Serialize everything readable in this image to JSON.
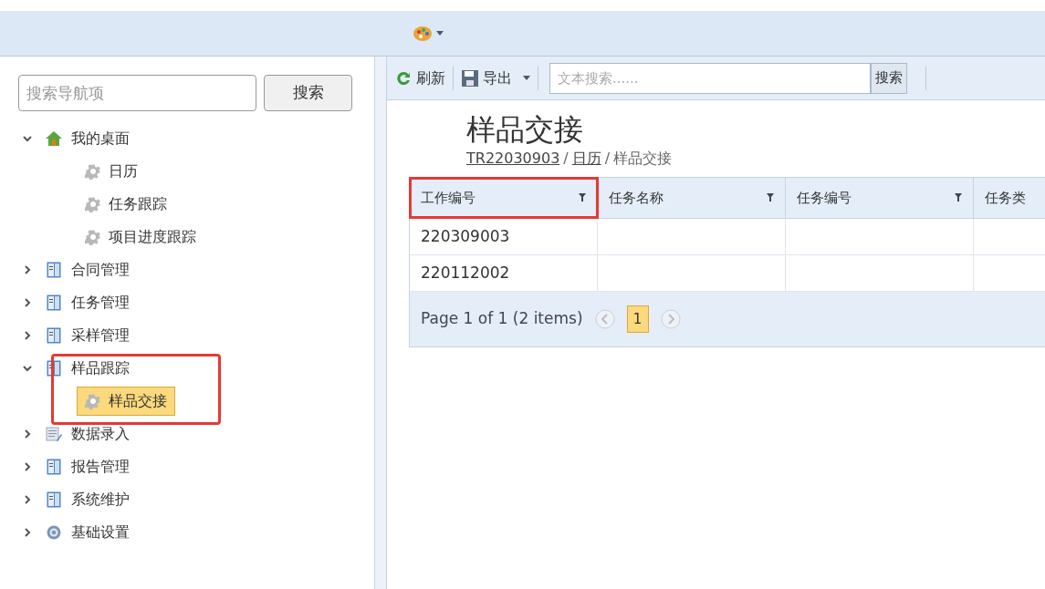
{
  "nav": {
    "search": {
      "placeholder": "搜索导航项"
    },
    "search_button": "搜索",
    "tree": [
      {
        "label": "我的桌面",
        "kind": "home",
        "expanded": true,
        "children": [
          {
            "label": "日历",
            "selected": false
          },
          {
            "label": "任务跟踪",
            "selected": false
          },
          {
            "label": "项目进度跟踪",
            "selected": false
          }
        ]
      },
      {
        "label": "合同管理",
        "kind": "book",
        "expanded": false
      },
      {
        "label": "任务管理",
        "kind": "book",
        "expanded": false
      },
      {
        "label": "采样管理",
        "kind": "book",
        "expanded": false
      },
      {
        "label": "样品跟踪",
        "kind": "book",
        "expanded": true,
        "annotated": true,
        "children": [
          {
            "label": "样品交接",
            "selected": true
          }
        ]
      },
      {
        "label": "数据录入",
        "kind": "list",
        "expanded": false
      },
      {
        "label": "报告管理",
        "kind": "book",
        "expanded": false
      },
      {
        "label": "系统维护",
        "kind": "book",
        "expanded": false
      },
      {
        "label": "基础设置",
        "kind": "gear",
        "expanded": false
      }
    ]
  },
  "toolbar": {
    "refresh": "刷新",
    "export": "导出",
    "search": {
      "placeholder": "文本搜索......"
    },
    "search_button": "搜索"
  },
  "page": {
    "title": "样品交接",
    "breadcrumb": [
      {
        "label": "TR22030903",
        "link": true
      },
      {
        "label": "/"
      },
      {
        "label": "日历",
        "link": true
      },
      {
        "label": "/"
      },
      {
        "label": "样品交接",
        "link": false
      }
    ]
  },
  "table": {
    "columns": [
      {
        "label": "工作编号",
        "annotated": true,
        "filter": true
      },
      {
        "label": "任务名称",
        "annotated": false,
        "filter": true
      },
      {
        "label": "任务编号",
        "annotated": false,
        "filter": true
      },
      {
        "label": "任务类",
        "annotated": false
      }
    ],
    "rows": [
      [
        "220309003",
        "",
        "",
        ""
      ],
      [
        "220112002",
        "",
        "",
        ""
      ]
    ],
    "pager": {
      "summary": "Page 1 of 1 (2 items)",
      "pages": [
        {
          "label": "1",
          "selected": true
        }
      ]
    }
  }
}
